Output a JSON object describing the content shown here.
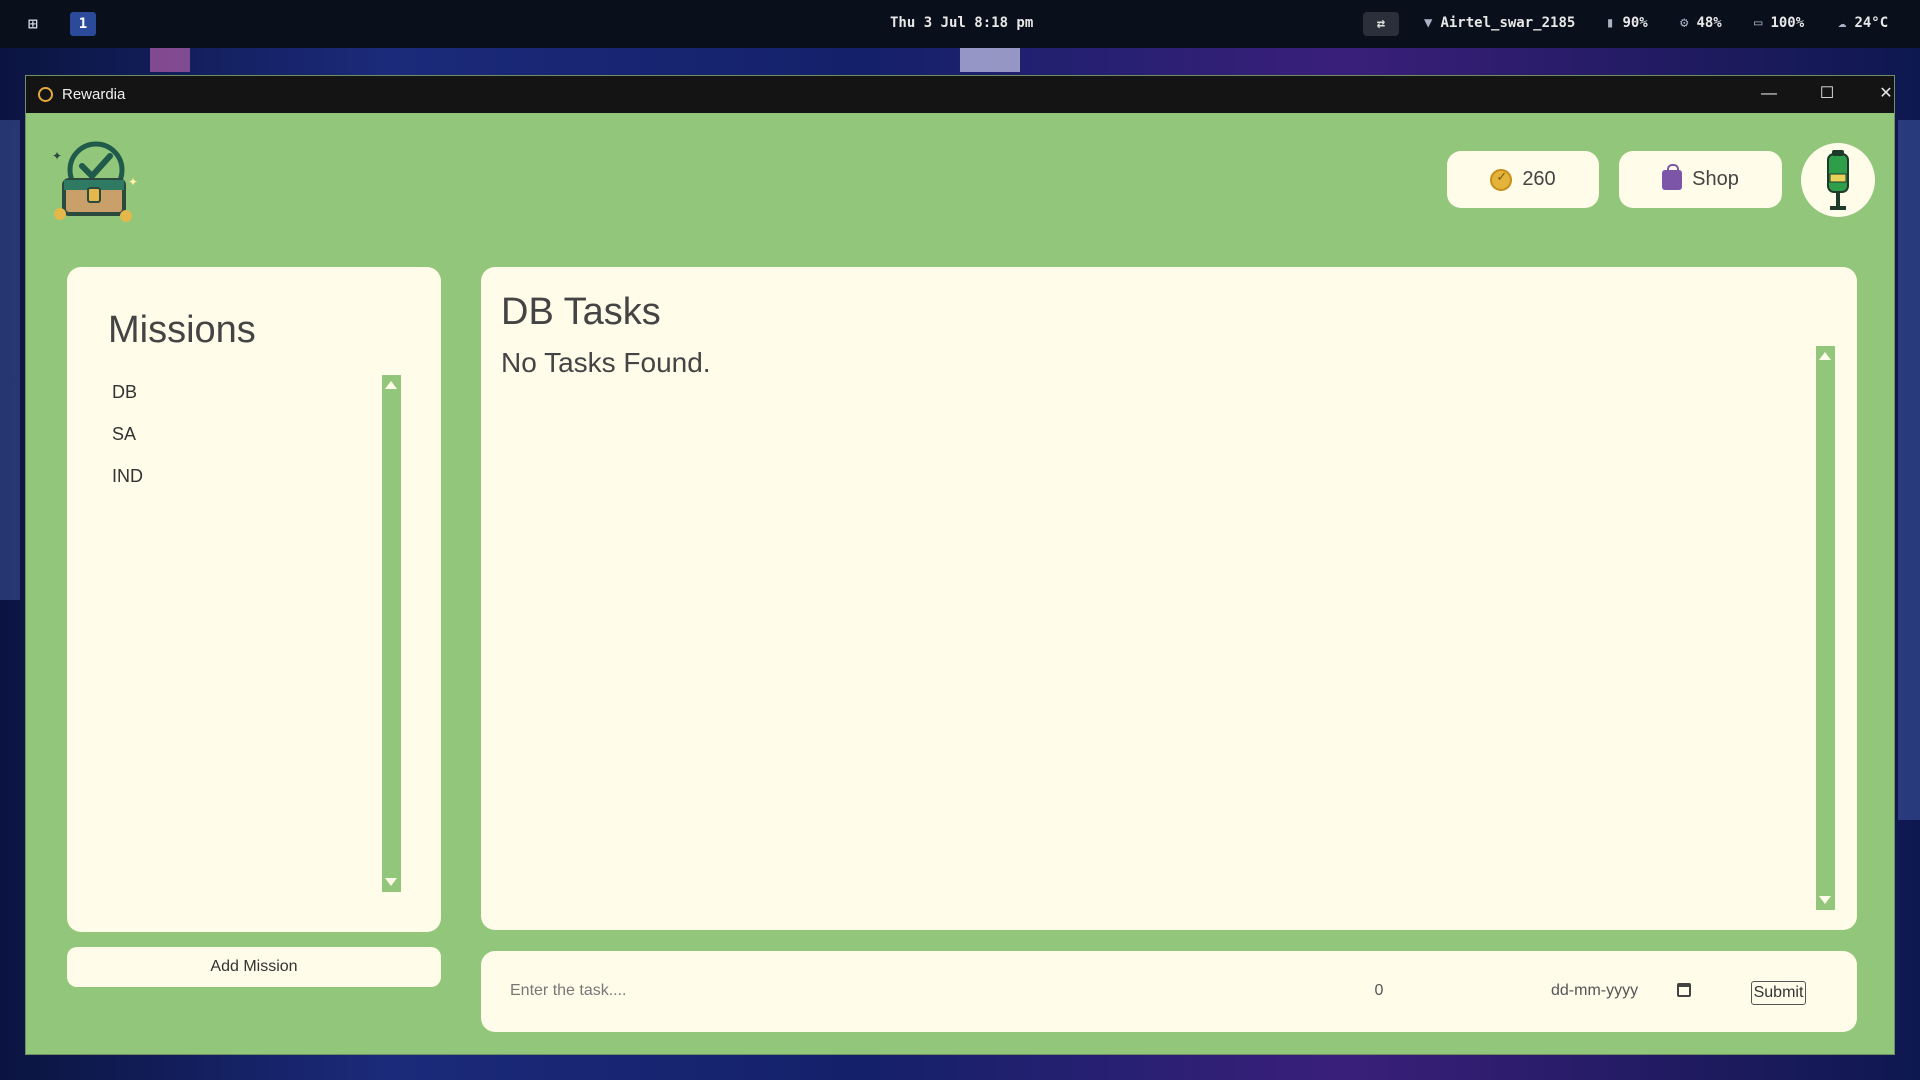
{
  "taskbar": {
    "workspace": "1",
    "clock": "Thu 3 Jul 8:18 pm",
    "wifi": "Airtel_swar_2185",
    "battery": "90%",
    "cpu": "48%",
    "memory": "100%",
    "temperature": "24°C"
  },
  "window": {
    "title": "Rewardia",
    "minimize": "—",
    "maximize": "☐",
    "close": "✕"
  },
  "header": {
    "coins": "260",
    "shop_label": "Shop"
  },
  "missions": {
    "heading": "Missions",
    "items": [
      "DB",
      "SA",
      "IND"
    ],
    "add_label": "Add Mission"
  },
  "tasks": {
    "heading": "DB Tasks",
    "empty_text": "No Tasks Found."
  },
  "task_form": {
    "task_placeholder": "Enter the task....",
    "points_value": "0",
    "date_placeholder": "dd-mm-yyyy",
    "submit_label": "Submit"
  },
  "colors": {
    "app_background": "#92c67a",
    "panel": "#fffcea",
    "titlebar": "#141414"
  }
}
